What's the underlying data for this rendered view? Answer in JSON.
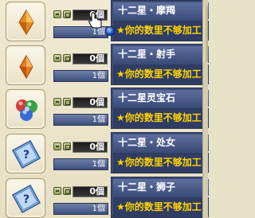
{
  "colors": {
    "panel_bg": "#e8e2c8",
    "name_bg": "#3a4b78",
    "warning_text": "#ffd400"
  },
  "items": [
    {
      "name": "十二星・摩羯",
      "count": "0個",
      "unit": "1個",
      "warning": "★你的数里不够加工",
      "icon": "orange-diamond-icon"
    },
    {
      "name": "十二星・射手",
      "count": "0個",
      "unit": "1個",
      "warning": "★你的数里不够加工",
      "icon": "orange-diamond-icon"
    },
    {
      "name": "十二星灵宝石",
      "count": "0個",
      "unit": "1個",
      "warning": "★你的数里不够加工",
      "icon": "tricolor-gems-icon"
    },
    {
      "name": "十二星・处女",
      "count": "0個",
      "unit": "1個",
      "warning": "★你的数里不够加工",
      "icon": "blue-question-card-icon"
    },
    {
      "name": "十二星・狮子",
      "count": "0個",
      "unit": "1個",
      "warning": "★你的数里不够加工",
      "icon": "blue-question-card-icon"
    }
  ]
}
